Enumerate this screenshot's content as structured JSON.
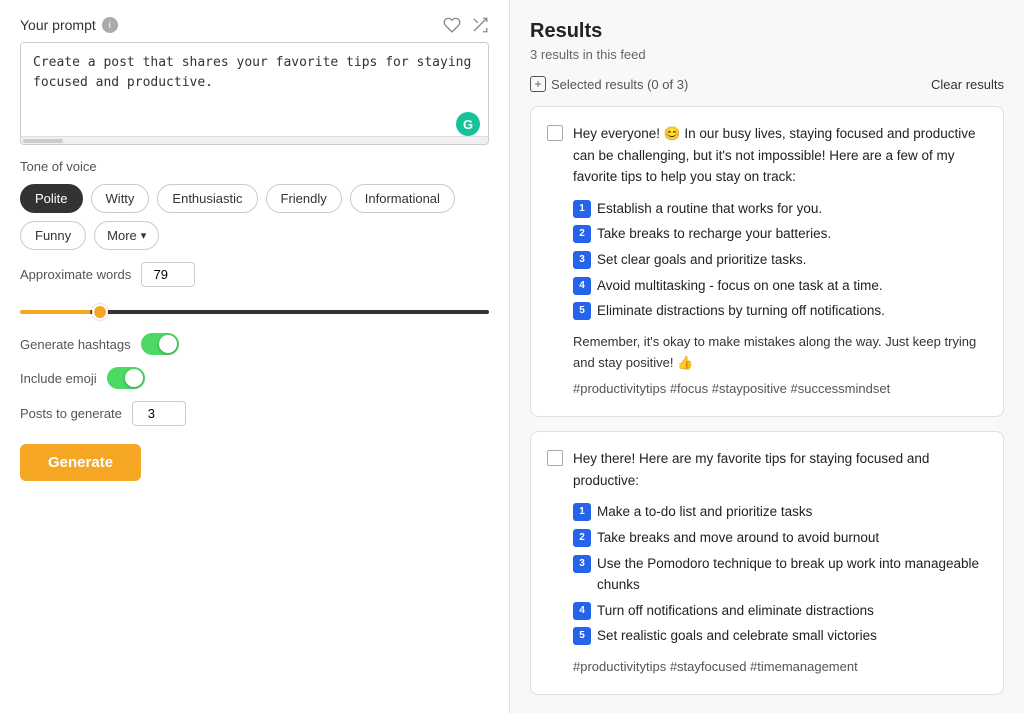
{
  "left": {
    "prompt_title": "Your prompt",
    "prompt_text": "Create a post that shares your favorite tips for staying focused and productive.",
    "tone_label": "Tone of voice",
    "tones": [
      {
        "id": "polite",
        "label": "Polite",
        "active": true
      },
      {
        "id": "witty",
        "label": "Witty",
        "active": false
      },
      {
        "id": "enthusiastic",
        "label": "Enthusiastic",
        "active": false
      },
      {
        "id": "friendly",
        "label": "Friendly",
        "active": false
      },
      {
        "id": "informational",
        "label": "Informational",
        "active": false
      }
    ],
    "more_label": "More",
    "funny_label": "Funny",
    "approx_words_label": "Approximate words",
    "approx_words_value": "79",
    "generate_hashtags_label": "Generate hashtags",
    "include_emoji_label": "Include emoji",
    "posts_to_generate_label": "Posts to generate",
    "posts_to_generate_value": "3",
    "generate_btn_label": "Generate"
  },
  "right": {
    "results_title": "Results",
    "results_count": "3 results in this feed",
    "selected_label": "Selected results (0 of 3)",
    "clear_label": "Clear results",
    "cards": [
      {
        "intro": "Hey everyone! 😊 In our busy lives, staying focused and productive can be challenging, but it's not impossible! Here are a few of my favorite tips to help you stay on track:",
        "items": [
          "Establish a routine that works for you.",
          "Take breaks to recharge your batteries.",
          "Set clear goals and prioritize tasks.",
          "Avoid multitasking - focus on one task at a time.",
          "Eliminate distractions by turning off notifications."
        ],
        "outro": "Remember, it's okay to make mistakes along the way. Just keep trying and stay positive! 👍",
        "hashtags": "#productivitytips #focus #staypositive #successmindset"
      },
      {
        "intro": "Hey there! Here are my favorite tips for staying focused and productive:",
        "items": [
          "Make a to-do list and prioritize tasks",
          "Take breaks and move around to avoid burnout",
          "Use the Pomodoro technique to break up work into manageable chunks",
          "Turn off notifications and eliminate distractions",
          "Set realistic goals and celebrate small victories"
        ],
        "outro": "",
        "hashtags": "#productivitytips #stayfocused #timemanagement"
      }
    ]
  }
}
